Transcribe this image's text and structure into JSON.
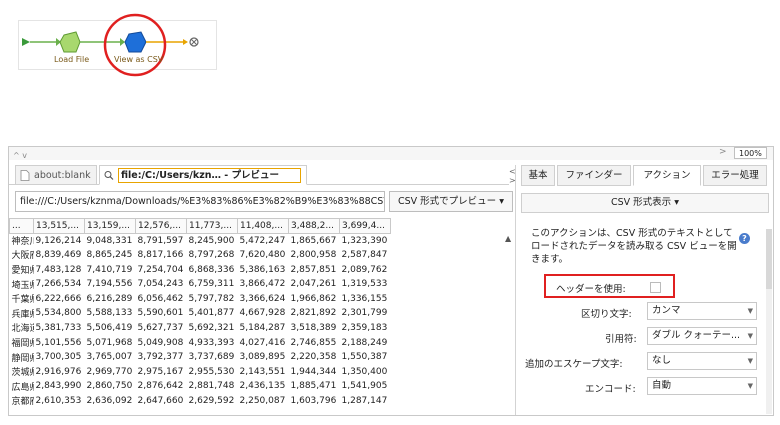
{
  "workflow": {
    "nodes": [
      {
        "label": "Load File"
      },
      {
        "label": "View as CSV"
      }
    ]
  },
  "toolbar": {
    "zoom_level": "100%",
    "zoom_arrow": ">",
    "collapse_arrows": "^ v"
  },
  "browser": {
    "tabs": [
      {
        "label": "about:blank"
      },
      {
        "label": "file:/C:/Users/kzn… - プレビュー"
      }
    ],
    "url": "file:///C:/Users/kznma/Downloads/%E3%83%86%E3%82%B9%E3%83%88CSV",
    "preview_button_label": "CSV 形式でプレビュー ▾"
  },
  "table": {
    "headers": [
      "...",
      "13,515,...",
      "13,159,...",
      "12,576,...",
      "11,773,...",
      "11,408,...",
      "3,488,2...",
      "3,699,4..."
    ],
    "rows": [
      [
        "神奈川",
        "9,126,214",
        "9,048,331",
        "8,791,597",
        "8,245,900",
        "5,472,247",
        "1,865,667",
        "1,323,390"
      ],
      [
        "大阪府",
        "8,839,469",
        "8,865,245",
        "8,817,166",
        "8,797,268",
        "7,620,480",
        "2,800,958",
        "2,587,847"
      ],
      [
        "愛知県",
        "7,483,128",
        "7,410,719",
        "7,254,704",
        "6,868,336",
        "5,386,163",
        "2,857,851",
        "2,089,762"
      ],
      [
        "埼玉県",
        "7,266,534",
        "7,194,556",
        "7,054,243",
        "6,759,311",
        "3,866,472",
        "2,047,261",
        "1,319,533"
      ],
      [
        "千葉県",
        "6,222,666",
        "6,216,289",
        "6,056,462",
        "5,797,782",
        "3,366,624",
        "1,966,862",
        "1,336,155"
      ],
      [
        "兵庫県",
        "5,534,800",
        "5,588,133",
        "5,590,601",
        "5,401,877",
        "4,667,928",
        "2,821,892",
        "2,301,799"
      ],
      [
        "北海道",
        "5,381,733",
        "5,506,419",
        "5,627,737",
        "5,692,321",
        "5,184,287",
        "3,518,389",
        "2,359,183"
      ],
      [
        "福岡県",
        "5,101,556",
        "5,071,968",
        "5,049,908",
        "4,933,393",
        "4,027,416",
        "2,746,855",
        "2,188,249"
      ],
      [
        "静岡県",
        "3,700,305",
        "3,765,007",
        "3,792,377",
        "3,737,689",
        "3,089,895",
        "2,220,358",
        "1,550,387"
      ],
      [
        "茨城県",
        "2,916,976",
        "2,969,770",
        "2,975,167",
        "2,955,530",
        "2,143,551",
        "1,944,344",
        "1,350,400"
      ],
      [
        "広島県",
        "2,843,990",
        "2,860,750",
        "2,876,642",
        "2,881,748",
        "2,436,135",
        "1,885,471",
        "1,541,905"
      ],
      [
        "京都府",
        "2,610,353",
        "2,636,092",
        "2,647,660",
        "2,629,592",
        "2,250,087",
        "1,603,796",
        "1,287,147"
      ]
    ]
  },
  "panel": {
    "tabs": [
      {
        "label": "基本"
      },
      {
        "label": "ファインダー"
      },
      {
        "label": "アクション"
      },
      {
        "label": "エラー処理"
      }
    ],
    "active_tab": "アクション",
    "format_dropdown": "CSV 形式表示 ▾",
    "description": "このアクションは、CSV 形式のテキストとしてロードされたデータを読み取る CSV ビューを開きます。",
    "header_label": "ヘッダーを使用:",
    "header_checked": false,
    "delimiter_label": "区切り文字:",
    "delimiter_value": "カンマ",
    "quote_label": "引用符:",
    "quote_value": "ダブル クォーテー...",
    "escape_label": "追加のエスケープ文字:",
    "escape_value": "なし",
    "encode_label": "エンコード:",
    "encode_value": "自動"
  },
  "colors": {
    "load_node": "#a8d86e",
    "view_node": "#1e6fd9",
    "highlight": "#e02020",
    "tab_outline": "#e8a400"
  }
}
